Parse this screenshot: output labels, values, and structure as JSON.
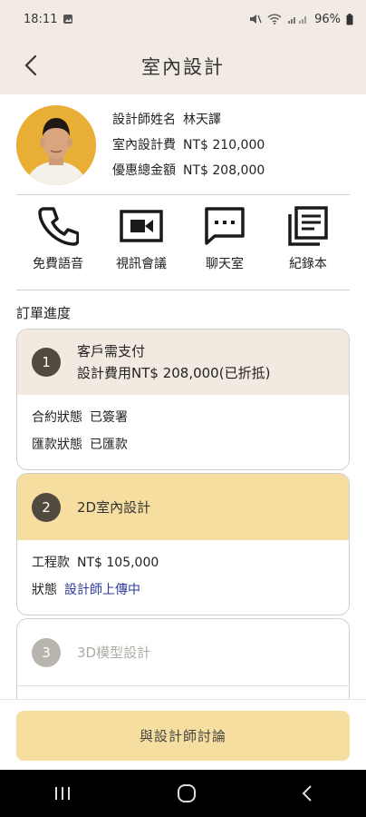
{
  "status_bar": {
    "time": "18:11",
    "battery": "96%"
  },
  "app_bar": {
    "title": "室內設計"
  },
  "designer": {
    "name_label": "設計師姓名",
    "name": "林天譯",
    "fee_label": "室內設計費",
    "fee": "NT$ 210,000",
    "discount_label": "優惠總金額",
    "discount": "NT$ 208,000"
  },
  "actions": [
    {
      "label": "免費語音",
      "icon": "phone-icon"
    },
    {
      "label": "視訊會議",
      "icon": "video-icon"
    },
    {
      "label": "聊天室",
      "icon": "chat-icon"
    },
    {
      "label": "紀錄本",
      "icon": "notebook-icon"
    }
  ],
  "order": {
    "section_title": "訂單進度",
    "steps": [
      {
        "number": "1",
        "title": "客戶需支付",
        "subtitle": "設計費用NT$ 208,000(已折抵)",
        "rows": [
          {
            "label": "合約狀態",
            "value": "已簽署"
          },
          {
            "label": "匯款狀態",
            "value": "已匯款"
          }
        ]
      },
      {
        "number": "2",
        "title": "2D室內設計",
        "rows": [
          {
            "label": "工程款",
            "value": "NT$ 105,000"
          },
          {
            "label": "狀態",
            "value": "設計師上傳中"
          }
        ]
      },
      {
        "number": "3",
        "title": "3D模型設計"
      }
    ]
  },
  "bottom": {
    "discuss_label": "與設計師討論"
  },
  "colors": {
    "header_bg": "#f2ebe4",
    "step_done_bg": "#f2e9e1",
    "step_active_bg": "#f6dea0",
    "status_link": "#2f3a9e",
    "number_dark": "#514a3f",
    "number_disabled": "#b8b4ae"
  }
}
